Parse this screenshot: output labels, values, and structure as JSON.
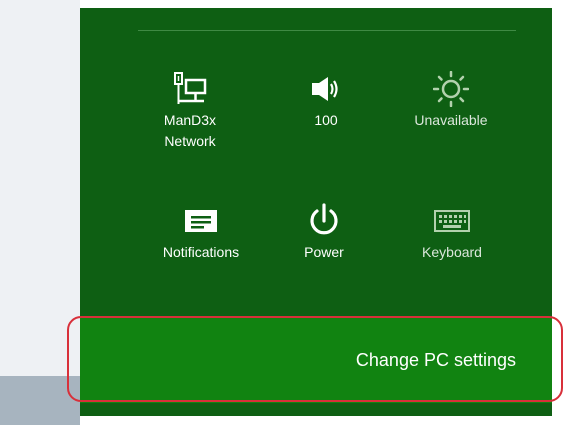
{
  "quick_settings": {
    "network": {
      "label": "ManD3x\nNetwork",
      "icon": "network-icon"
    },
    "volume": {
      "label": "100",
      "icon": "speaker-icon"
    },
    "brightness": {
      "label": "Unavailable",
      "icon": "brightness-icon"
    },
    "notifications": {
      "label": "Notifications",
      "icon": "notifications-icon"
    },
    "power": {
      "label": "Power",
      "icon": "power-icon"
    },
    "keyboard": {
      "label": "Keyboard",
      "icon": "keyboard-icon"
    }
  },
  "settings_link": {
    "label": "Change PC settings"
  },
  "colors": {
    "charms_background": "#0e5f13",
    "settings_bar": "#118311",
    "highlight": "#d8303a"
  }
}
